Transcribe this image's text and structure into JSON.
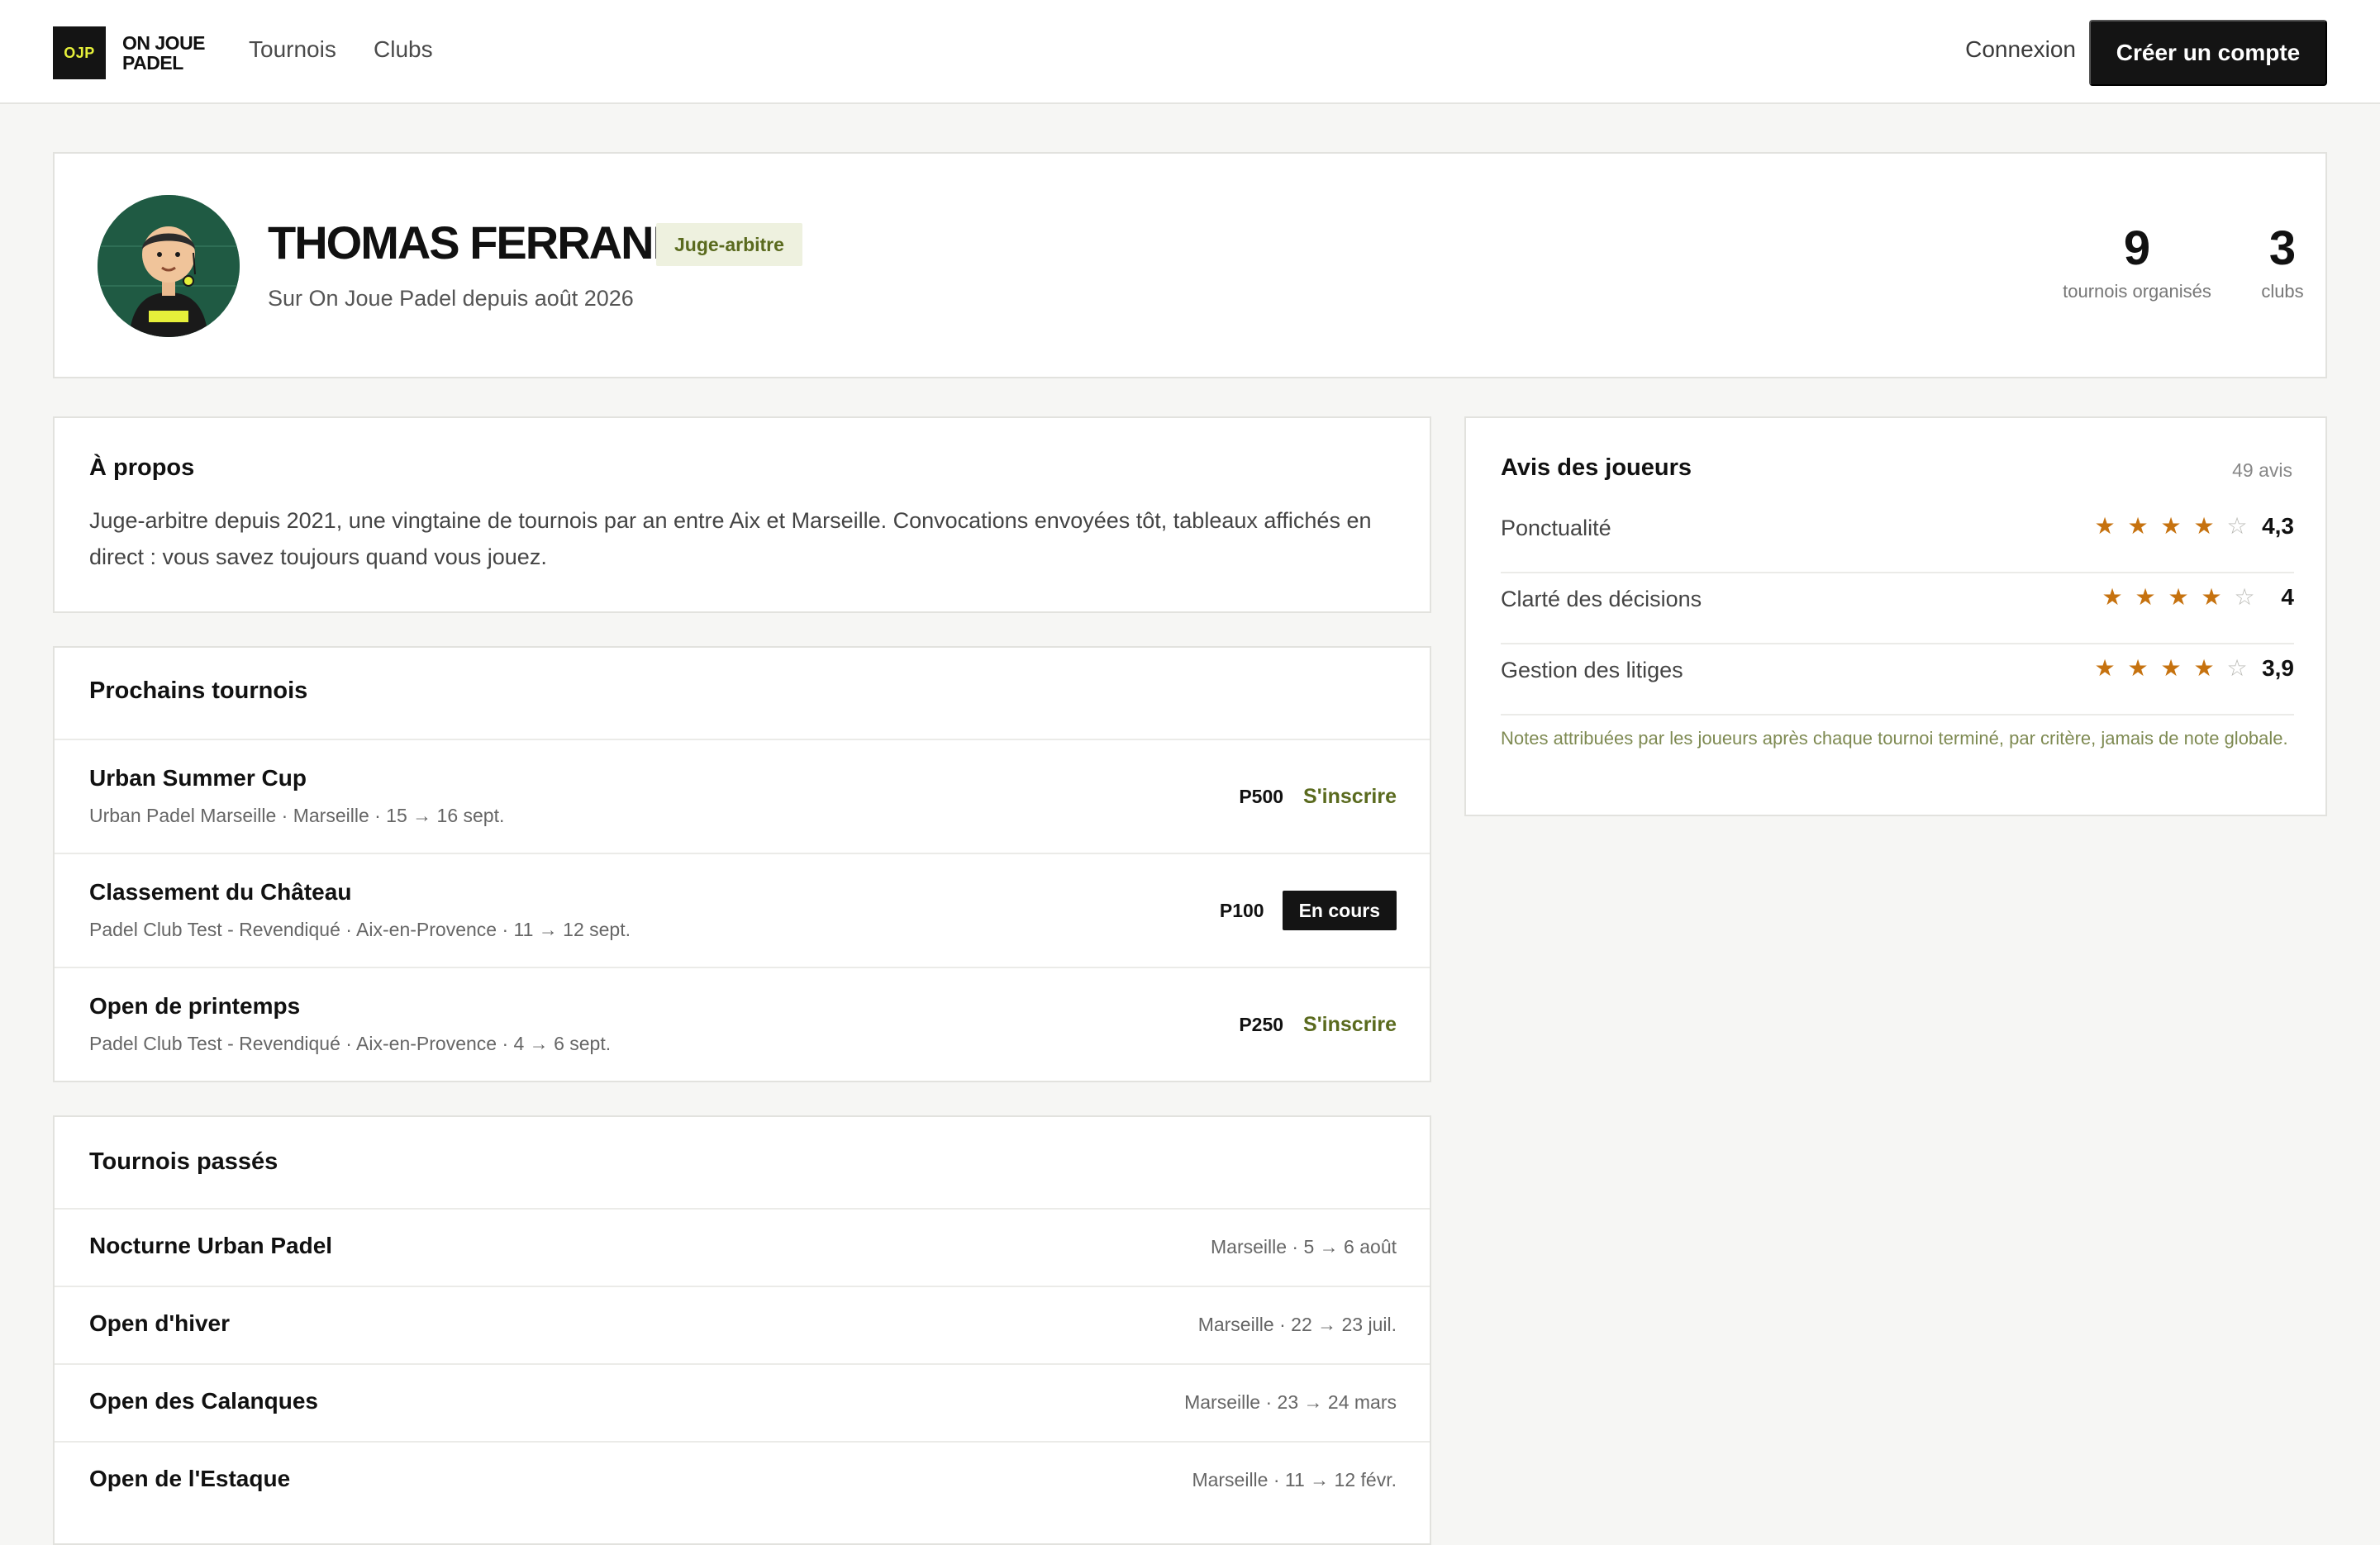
{
  "header": {
    "logo_mark": "OJP",
    "logo_line1": "ON JOUE",
    "logo_line2": "PADEL",
    "nav": {
      "tournois": "Tournois",
      "clubs": "Clubs"
    },
    "login": "Connexion",
    "signup": "Créer un compte"
  },
  "profile": {
    "name": "THOMAS FERRAND",
    "role": "Juge-arbitre",
    "member_since": "Sur On Joue Padel depuis août 2026",
    "stats": [
      {
        "value": "9",
        "label": "tournois organisés"
      },
      {
        "value": "3",
        "label": "clubs"
      }
    ]
  },
  "about": {
    "title": "À propos",
    "text": "Juge-arbitre depuis 2021, une vingtaine de tournois par an entre Aix et Marseille. Convocations envoyées tôt, tableaux affichés en direct : vous savez toujours quand vous jouez."
  },
  "upcoming": {
    "title": "Prochains tournois",
    "items": [
      {
        "name": "Urban Summer Cup",
        "meta": "Urban Padel Marseille · Marseille · 15 → 16 sept.",
        "level": "P500",
        "action": "S'inscrire"
      },
      {
        "name": "Classement du Château",
        "meta": "Padel Club Test - Revendiqué · Aix-en-Provence · 11 → 12 sept.",
        "level": "P100",
        "status": "En cours"
      },
      {
        "name": "Open de printemps",
        "meta": "Padel Club Test - Revendiqué · Aix-en-Provence · 4 → 6 sept.",
        "level": "P250",
        "action": "S'inscrire"
      }
    ]
  },
  "past": {
    "title": "Tournois passés",
    "items": [
      {
        "name": "Nocturne Urban Padel",
        "meta": "Marseille · 5 → 6 août"
      },
      {
        "name": "Open d'hiver",
        "meta": "Marseille · 22 → 23 juil."
      },
      {
        "name": "Open des Calanques",
        "meta": "Marseille · 23 → 24 mars"
      },
      {
        "name": "Open de l'Estaque",
        "meta": "Marseille · 11 → 12 févr."
      }
    ]
  },
  "reviews": {
    "title": "Avis des joueurs",
    "count": "49 avis",
    "criteria": [
      {
        "label": "Ponctualité",
        "score": "4,3",
        "stars_filled": 4
      },
      {
        "label": "Clarté des décisions",
        "score": "4",
        "stars_filled": 4
      },
      {
        "label": "Gestion des litiges",
        "score": "3,9",
        "stars_filled": 4
      }
    ],
    "note": "Notes attribuées par les joueurs après chaque tournoi terminé, par critère, jamais de note globale."
  },
  "colors": {
    "accent_olive": "#5a6a1e",
    "star": "#c6720f",
    "dark": "#141414",
    "avatar_bg": "#1f5a43",
    "logo_yellow": "#e6f03a"
  },
  "icons": [
    "star-filled-icon",
    "star-empty-icon",
    "referee-avatar"
  ]
}
